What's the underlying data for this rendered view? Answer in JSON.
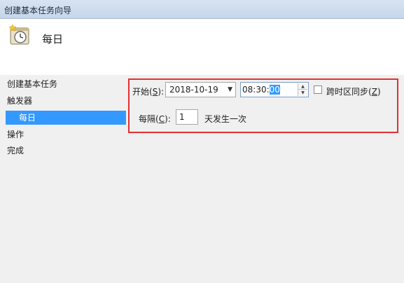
{
  "window": {
    "title": "创建基本任务向导"
  },
  "header": {
    "icon": "clock-calendar-icon",
    "page_title": "每日"
  },
  "nav": {
    "items": [
      {
        "label": "创建基本任务"
      },
      {
        "label": "触发器"
      },
      {
        "label": "每日",
        "selected": true
      },
      {
        "label": "操作"
      },
      {
        "label": "完成"
      }
    ]
  },
  "schedule": {
    "start_label": "开始",
    "start_accel": "S",
    "start_label_suffix": ":",
    "start_date": "2018-10-19",
    "date_dropdown_icon": "dropdown-arrow-icon",
    "time_prefix": "08:30:",
    "time_selected_part": "00",
    "sync_label": "跨时区同步",
    "sync_accel": "Z",
    "sync_checked": false,
    "interval_label": "每隔",
    "interval_accel": "C",
    "interval_label_suffix": ":",
    "interval_value": "1",
    "interval_unit": "天发生一次"
  },
  "colors": {
    "selection": "#3399ff",
    "highlight_border": "#e03131"
  }
}
